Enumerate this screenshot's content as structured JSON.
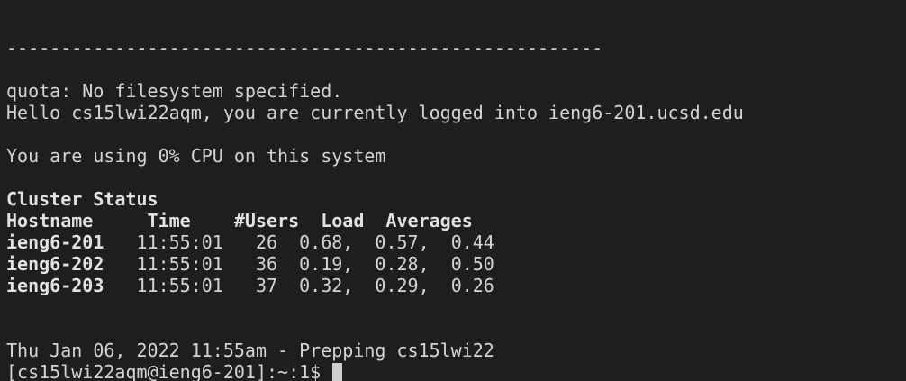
{
  "terminal": {
    "separator": "-------------------------------------------------------",
    "quota": "quota: No filesystem specified.",
    "hello": "Hello cs15lwi22aqm, you are currently logged into ieng6-201.ucsd.edu",
    "cpu": "You are using 0% CPU on this system",
    "cluster_title": "Cluster Status",
    "cluster_header": "Hostname     Time    #Users  Load  Averages",
    "rows": [
      {
        "host": "ieng6-201",
        "rest": "   11:55:01   26  0.68,  0.57,  0.44"
      },
      {
        "host": "ieng6-202",
        "rest": "   11:55:01   36  0.19,  0.28,  0.50"
      },
      {
        "host": "ieng6-203",
        "rest": "   11:55:01   37  0.32,  0.29,  0.26"
      }
    ],
    "date_line": "Thu Jan 06, 2022 11:55am - Prepping cs15lwi22",
    "prompt": "[cs15lwi22aqm@ieng6-201]:~:1$ "
  }
}
